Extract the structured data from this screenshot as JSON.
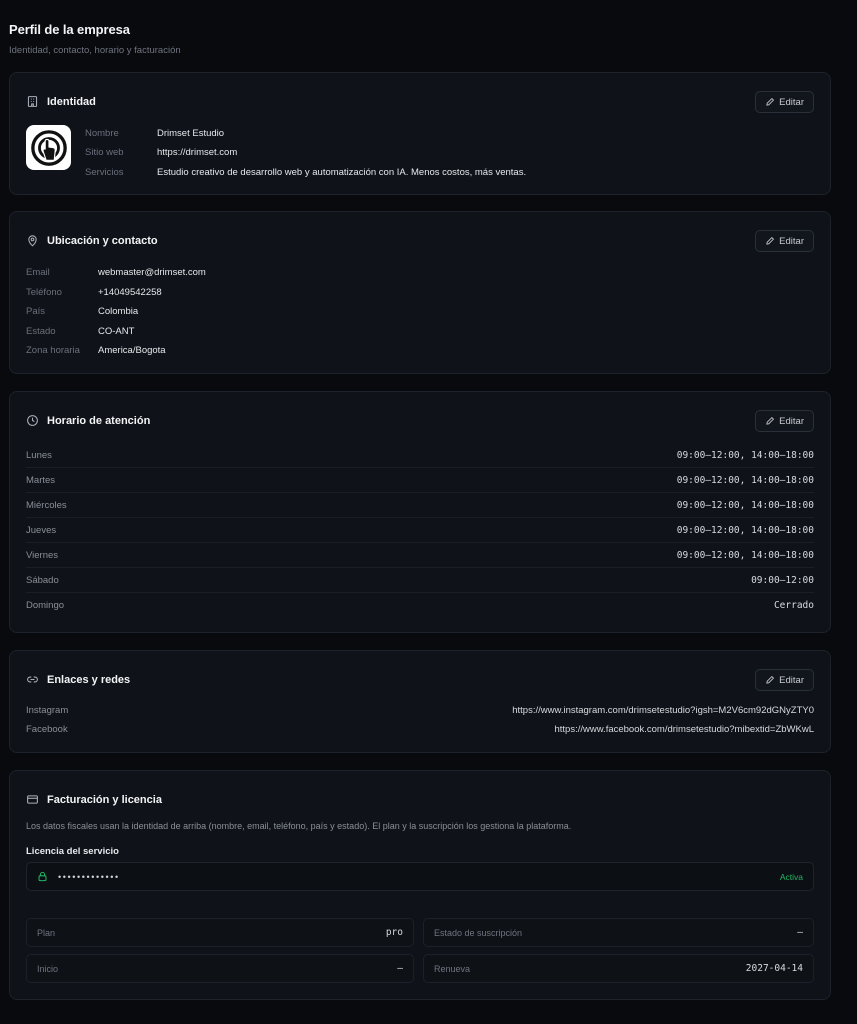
{
  "header": {
    "title": "Perfil de la empresa",
    "subtitle": "Identidad, contacto, horario y facturación"
  },
  "colors": {
    "background": "#090a0d",
    "card": "#0f1218",
    "accent_active": "#22b566"
  },
  "common": {
    "edit_label": "Editar"
  },
  "identity": {
    "title": "Identidad",
    "icon": "building-icon",
    "logo": "drimset-logo",
    "fields": [
      {
        "label": "Nombre",
        "value": "Drimset Estudio"
      },
      {
        "label": "Sitio web",
        "value": "https://drimset.com"
      },
      {
        "label": "Servicios",
        "value": "Estudio creativo de desarrollo web y automatización con IA. Menos costos, más ventas."
      }
    ]
  },
  "contact": {
    "title": "Ubicación y contacto",
    "icon": "map-pin-icon",
    "fields": [
      {
        "label": "Email",
        "value": "webmaster@drimset.com"
      },
      {
        "label": "Teléfono",
        "value": "+14049542258"
      },
      {
        "label": "País",
        "value": "Colombia"
      },
      {
        "label": "Estado",
        "value": "CO-ANT"
      },
      {
        "label": "Zona horaria",
        "value": "America/Bogota"
      }
    ]
  },
  "hours": {
    "title": "Horario de atención",
    "icon": "clock-icon",
    "days": [
      {
        "day": "Lunes",
        "time": "09:00–12:00, 14:00–18:00"
      },
      {
        "day": "Martes",
        "time": "09:00–12:00, 14:00–18:00"
      },
      {
        "day": "Miércoles",
        "time": "09:00–12:00, 14:00–18:00"
      },
      {
        "day": "Jueves",
        "time": "09:00–12:00, 14:00–18:00"
      },
      {
        "day": "Viernes",
        "time": "09:00–12:00, 14:00–18:00"
      },
      {
        "day": "Sábado",
        "time": "09:00–12:00"
      },
      {
        "day": "Domingo",
        "time": "Cerrado"
      }
    ]
  },
  "links": {
    "title": "Enlaces y redes",
    "icon": "link-icon",
    "items": [
      {
        "label": "Instagram",
        "value": "https://www.instagram.com/drimsetestudio?igsh=M2V6cm92dGNyZTY0"
      },
      {
        "label": "Facebook",
        "value": "https://www.facebook.com/drimsetestudio?mibextid=ZbWKwL"
      }
    ]
  },
  "billing": {
    "title": "Facturación y licencia",
    "icon": "credit-card-icon",
    "note": "Los datos fiscales usan la identidad de arriba (nombre, email, teléfono, país y estado). El plan y la suscripción los gestiona la plataforma.",
    "license_label": "Licencia del servicio",
    "license_mask": "•••••••••••••",
    "license_status": "Activa",
    "plan_label": "Plan",
    "plan_value": "pro",
    "subscription_label": "Estado de suscripción",
    "subscription_value": "—",
    "start_label": "Inicio",
    "start_value": "—",
    "renew_label": "Renueva",
    "renew_value": "2027-04-14"
  }
}
